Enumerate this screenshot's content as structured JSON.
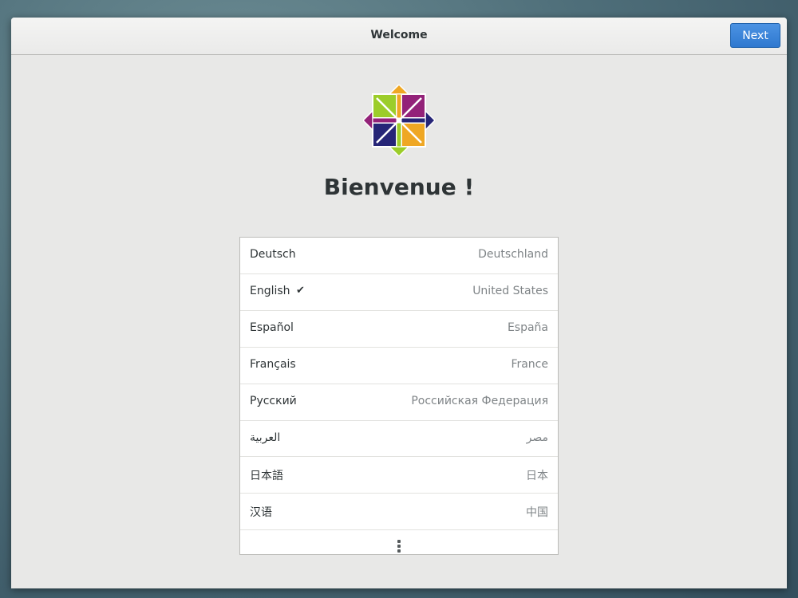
{
  "window": {
    "title": "Welcome",
    "next_label": "Next"
  },
  "main": {
    "logo": "centos-logo",
    "heading": "Bienvenue !"
  },
  "languages": [
    {
      "language": "Deutsch",
      "region": "Deutschland",
      "selected": false
    },
    {
      "language": "English",
      "region": "United States",
      "selected": true
    },
    {
      "language": "Español",
      "region": "España",
      "selected": false
    },
    {
      "language": "Français",
      "region": "France",
      "selected": false
    },
    {
      "language": "Русский",
      "region": "Российская Федерация",
      "selected": false
    },
    {
      "language": "العربية",
      "region": "مصر",
      "selected": false
    },
    {
      "language": "日本語",
      "region": "日本",
      "selected": false
    },
    {
      "language": "汉语",
      "region": "中国",
      "selected": false
    }
  ],
  "icons": {
    "selected_mark": "✔",
    "more": "vertical-ellipsis-icon"
  },
  "colors": {
    "accent": "#2f78cf",
    "logo_green": "#9ccd2a",
    "logo_purple": "#932279",
    "logo_orange": "#efa724",
    "logo_navy": "#262577"
  }
}
